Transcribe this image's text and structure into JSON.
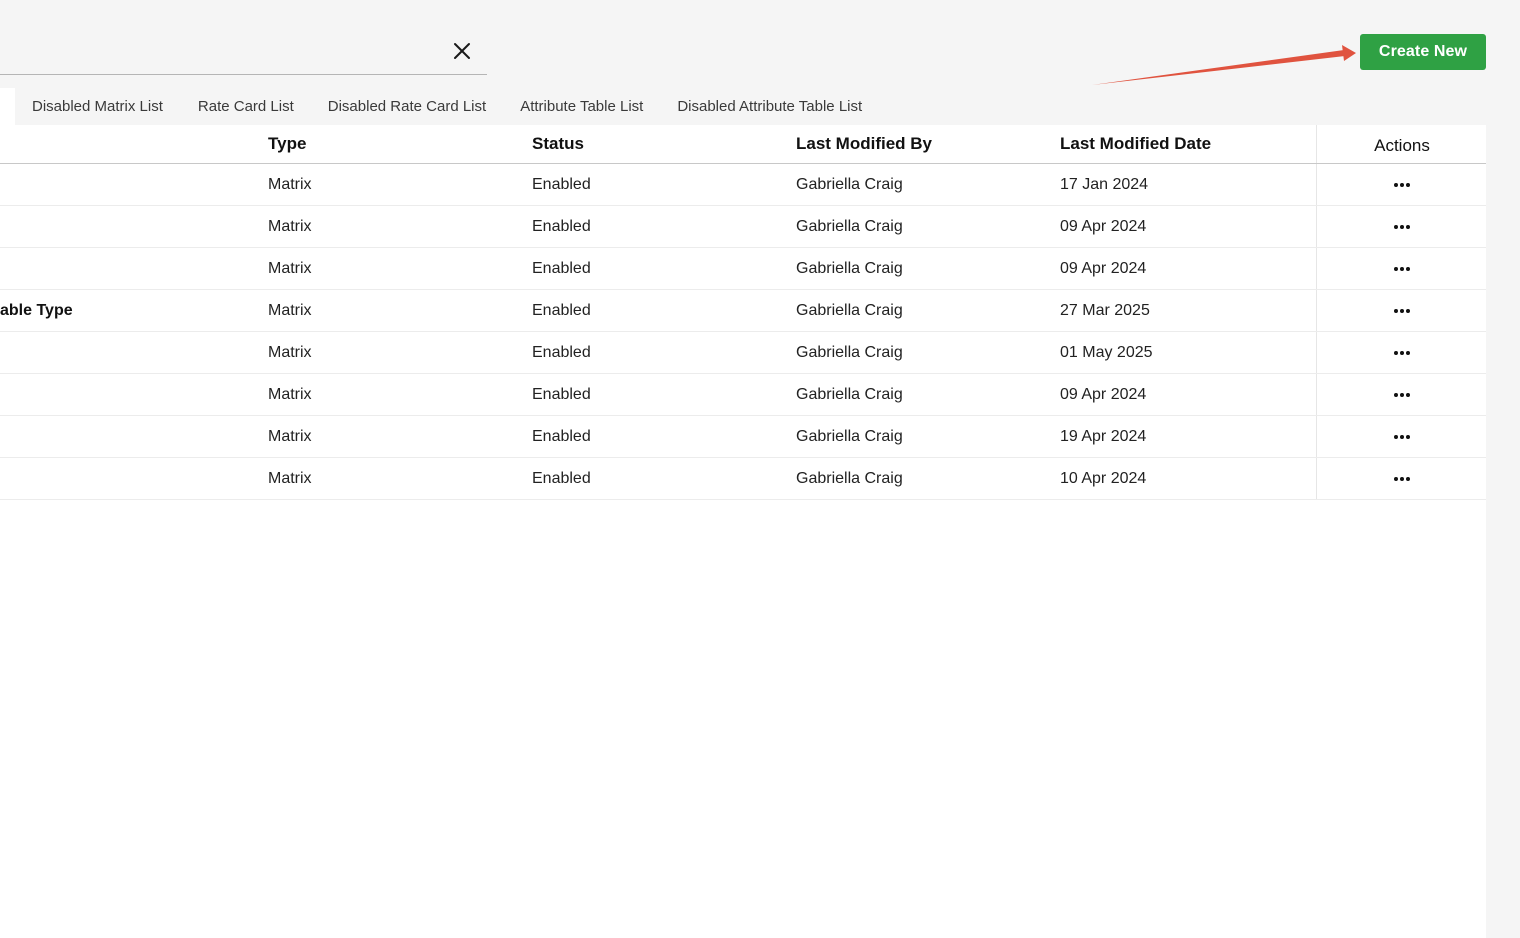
{
  "toolbar": {
    "create_label": "Create New",
    "create_color": "#2fa144",
    "clear_icon": "close-icon"
  },
  "tabs": [
    {
      "label": "Disabled Matrix List"
    },
    {
      "label": "Rate Card List"
    },
    {
      "label": "Disabled Rate Card List"
    },
    {
      "label": "Attribute Table List"
    },
    {
      "label": "Disabled Attribute Table List"
    }
  ],
  "table": {
    "headers": {
      "type": "Type",
      "status": "Status",
      "modified_by": "Last Modified By",
      "modified_date": "Last Modified Date",
      "actions": "Actions"
    },
    "rows": [
      {
        "name": "",
        "type": "Matrix",
        "status": "Enabled",
        "modified_by": "Gabriella Craig",
        "modified_date": "17 Jan 2024"
      },
      {
        "name": "",
        "type": "Matrix",
        "status": "Enabled",
        "modified_by": "Gabriella Craig",
        "modified_date": "09 Apr 2024"
      },
      {
        "name": "",
        "type": "Matrix",
        "status": "Enabled",
        "modified_by": "Gabriella Craig",
        "modified_date": "09 Apr 2024"
      },
      {
        "name": "able Type",
        "type": "Matrix",
        "status": "Enabled",
        "modified_by": "Gabriella Craig",
        "modified_date": "27 Mar 2025"
      },
      {
        "name": "",
        "type": "Matrix",
        "status": "Enabled",
        "modified_by": "Gabriella Craig",
        "modified_date": "01 May 2025"
      },
      {
        "name": "",
        "type": "Matrix",
        "status": "Enabled",
        "modified_by": "Gabriella Craig",
        "modified_date": "09 Apr 2024"
      },
      {
        "name": "",
        "type": "Matrix",
        "status": "Enabled",
        "modified_by": "Gabriella Craig",
        "modified_date": "19 Apr 2024"
      },
      {
        "name": "",
        "type": "Matrix",
        "status": "Enabled",
        "modified_by": "Gabriella Craig",
        "modified_date": "10 Apr 2024"
      }
    ],
    "row_action_icon": "more-horizontal-icon"
  },
  "annotation": {
    "arrow_color": "#e0533f",
    "arrow_target": "Create New"
  }
}
